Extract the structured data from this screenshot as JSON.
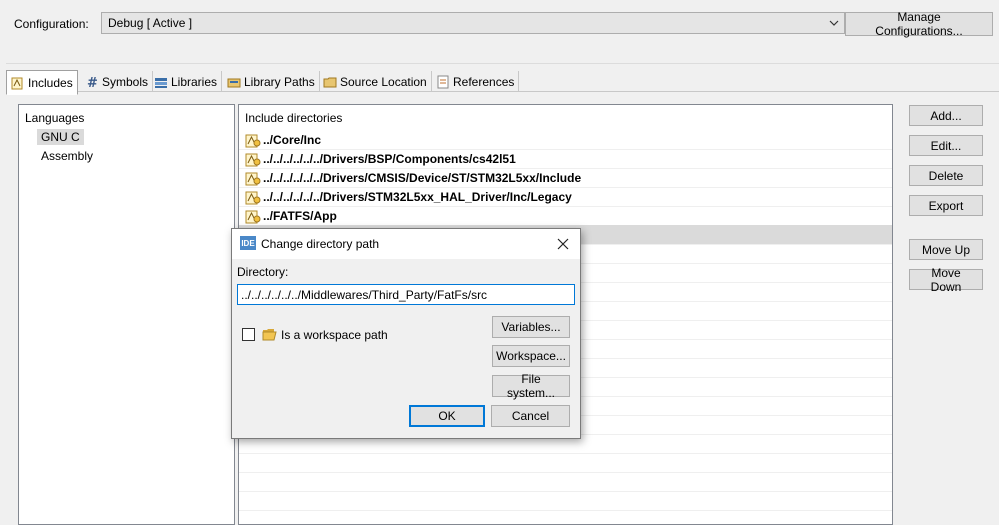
{
  "config": {
    "label": "Configuration:",
    "value": "Debug  [ Active ]",
    "manage_label": "Manage Configurations..."
  },
  "tabs": [
    {
      "label": "Includes",
      "icon": "includes-icon"
    },
    {
      "label": "Symbols",
      "icon": "hash-icon"
    },
    {
      "label": "Libraries",
      "icon": "library-icon"
    },
    {
      "label": "Library Paths",
      "icon": "library-paths-icon"
    },
    {
      "label": "Source Location",
      "icon": "source-folder-icon"
    },
    {
      "label": "References",
      "icon": "references-icon"
    }
  ],
  "languages": {
    "header": "Languages",
    "items": [
      "GNU C",
      "Assembly"
    ]
  },
  "includes": {
    "header": "Include directories",
    "items": [
      "../Core/Inc",
      "../../../../../../Drivers/BSP/Components/cs42l51",
      "../../../../../../Drivers/CMSIS/Device/ST/STM32L5xx/Include",
      "../../../../../../Drivers/STM32L5xx_HAL_Driver/Inc/Legacy",
      "../FATFS/App"
    ]
  },
  "side_buttons": {
    "add": "Add...",
    "edit": "Edit...",
    "delete": "Delete",
    "export": "Export",
    "move_up": "Move Up",
    "move_down": "Move Down"
  },
  "dialog": {
    "icon_text": "IDE",
    "title": "Change directory path",
    "directory_label": "Directory:",
    "directory_value": "../../../../../../Middlewares/Third_Party/FatFs/src",
    "workspace_checkbox_label": "Is a workspace path",
    "variables": "Variables...",
    "workspace": "Workspace...",
    "file_system": "File system...",
    "ok": "OK",
    "cancel": "Cancel"
  }
}
